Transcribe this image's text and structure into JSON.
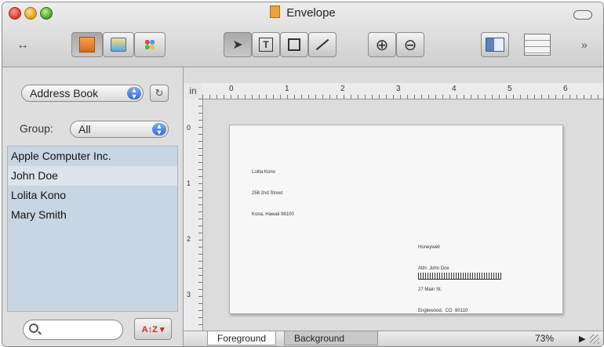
{
  "window": {
    "title": "Envelope"
  },
  "toolbar": {
    "resize_icon": "↔",
    "more_icon": "»",
    "zoom_in_icon": "⊕",
    "zoom_out_icon": "⊖",
    "text_tool_label": "T"
  },
  "sidebar": {
    "source_popup": "Address Book",
    "group_label": "Group:",
    "group_popup": "All",
    "contacts": [
      {
        "name": "Apple Computer Inc."
      },
      {
        "name": "John Doe"
      },
      {
        "name": "Lolita Kono"
      },
      {
        "name": "Mary Smith"
      }
    ],
    "search_placeholder": ""
  },
  "ruler": {
    "unit": "in",
    "h_marks": [
      "0",
      "1",
      "2",
      "3",
      "4",
      "5",
      "6"
    ],
    "v_marks": [
      "0",
      "1",
      "2",
      "3"
    ]
  },
  "envelope": {
    "return_address": [
      "Lolita Kono",
      "258 2nd Street",
      "Kona, Hawaii 98100"
    ],
    "recipient_address": [
      "Honeywell",
      "Attn: John Doe",
      "27 Main St.",
      "Englewood,  CO  80110"
    ]
  },
  "footer": {
    "tabs": [
      "Foreground",
      "Background"
    ],
    "zoom": "73%",
    "zoom_arrow": "▶"
  }
}
